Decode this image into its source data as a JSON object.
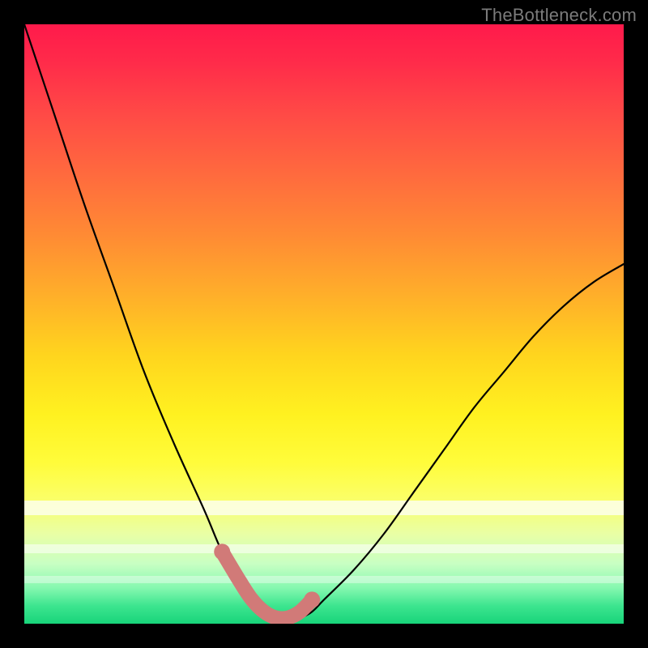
{
  "watermark": "TheBottleneck.com",
  "chart_data": {
    "type": "line",
    "title": "",
    "xlabel": "",
    "ylabel": "",
    "xlim": [
      0,
      100
    ],
    "ylim": [
      0,
      100
    ],
    "grid": false,
    "legend": false,
    "series": [
      {
        "name": "bottleneck-curve",
        "x": [
          0,
          5,
          10,
          15,
          20,
          25,
          30,
          33,
          36,
          38,
          40,
          42,
          44,
          46,
          48,
          50,
          55,
          60,
          65,
          70,
          75,
          80,
          85,
          90,
          95,
          100
        ],
        "y": [
          100,
          85,
          70,
          56,
          42,
          30,
          19,
          12,
          7,
          4,
          2,
          1,
          1,
          1,
          2,
          4,
          9,
          15,
          22,
          29,
          36,
          42,
          48,
          53,
          57,
          60
        ]
      }
    ],
    "highlight": {
      "name": "optimal-range",
      "x": [
        33,
        36,
        38,
        40,
        42,
        44,
        46,
        48
      ],
      "y": [
        12,
        7,
        4,
        2,
        1,
        1,
        2,
        4
      ]
    },
    "background_gradient": {
      "top": "#ff1a4b",
      "middle": "#ffe21e",
      "bottom": "#18d47a"
    }
  }
}
